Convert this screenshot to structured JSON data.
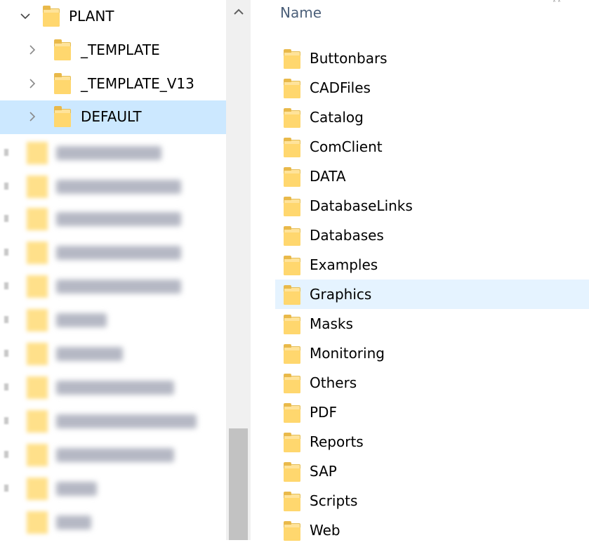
{
  "navigation_pane": {
    "root": {
      "label": "PLANT",
      "expanded": true
    },
    "children": [
      {
        "label": "_TEMPLATE"
      },
      {
        "label": "_TEMPLATE_V13"
      },
      {
        "label": "DEFAULT",
        "selected": true
      }
    ],
    "obscured_items_count": 13
  },
  "content_pane": {
    "column_header": "Name",
    "folders": [
      "Buttonbars",
      "CADFiles",
      "Catalog",
      "ComClient",
      "DATA",
      "DatabaseLinks",
      "Databases",
      "Examples",
      "Graphics",
      "Masks",
      "Monitoring",
      "Others",
      "PDF",
      "Reports",
      "SAP",
      "Scripts",
      "Web"
    ],
    "hovered_folder": "Graphics"
  },
  "icons": {
    "expanded_chevron": "chevron-down-icon",
    "collapsed_chevron": "chevron-right-icon",
    "folder": "folder-icon",
    "scroll_up": "chevron-up-icon"
  },
  "colors": {
    "selected_row": "#cce8ff",
    "hover_row": "#e5f3ff",
    "folder_yellow": "#ffd76e",
    "header_text": "#4c607a"
  }
}
